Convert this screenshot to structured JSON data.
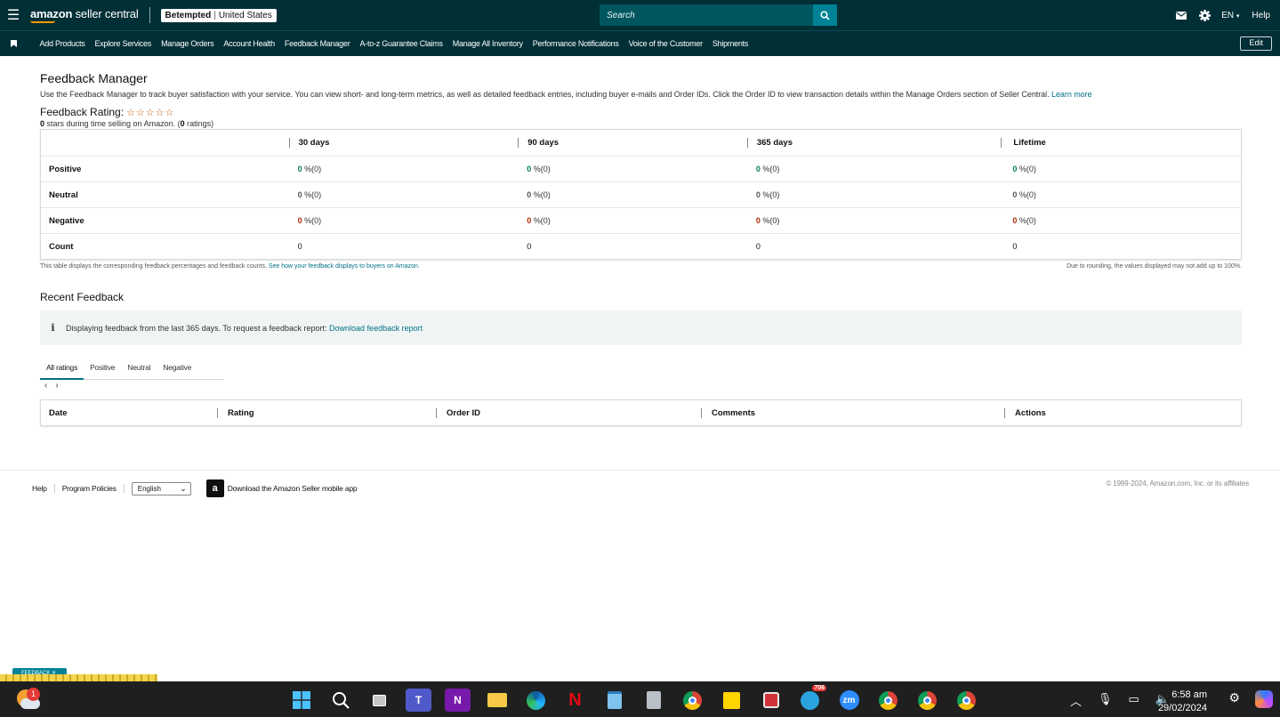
{
  "topbar": {
    "logo_brand": "amazon",
    "logo_suffix": "seller central",
    "store_name": "Betempted",
    "store_region": "United States",
    "search_placeholder": "Search",
    "language": "EN",
    "help": "Help"
  },
  "nav": {
    "items": [
      "Add Products",
      "Explore Services",
      "Manage Orders",
      "Account Health",
      "Feedback Manager",
      "A-to-z Guarantee Claims",
      "Manage All Inventory",
      "Performance Notifications",
      "Voice of the Customer",
      "Shipments"
    ],
    "edit": "Edit"
  },
  "page": {
    "title": "Feedback Manager",
    "intro": "Use the Feedback Manager to track buyer satisfaction with your service. You can view short- and long-term metrics, as well as detailed feedback entries, including buyer e-mails and Order IDs. Click the Order ID to view transaction details within the Manage Orders section of Seller Central.",
    "learn_more": "Learn more",
    "rating_label": "Feedback Rating:",
    "stars": "☆☆☆☆☆",
    "stars_count": "0",
    "stars_text_1": " stars during time selling on Amazon. (",
    "ratings_count": "0",
    "stars_text_2": " ratings)"
  },
  "feedback_table": {
    "columns": [
      "30 days",
      "90 days",
      "365 days",
      "Lifetime"
    ],
    "rows": [
      {
        "label": "Positive",
        "cells": [
          {
            "n": "0",
            "p": " %(0)"
          },
          {
            "n": "0",
            "p": " %(0)"
          },
          {
            "n": "0",
            "p": " %(0)"
          },
          {
            "n": "0",
            "p": " %(0)"
          }
        ]
      },
      {
        "label": "Neutral",
        "cells": [
          {
            "n": "0",
            "p": " %(0)"
          },
          {
            "n": "0",
            "p": " %(0)"
          },
          {
            "n": "0",
            "p": " %(0)"
          },
          {
            "n": "0",
            "p": " %(0)"
          }
        ]
      },
      {
        "label": "Negative",
        "cells": [
          {
            "n": "0",
            "p": " %(0)"
          },
          {
            "n": "0",
            "p": " %(0)"
          },
          {
            "n": "0",
            "p": " %(0)"
          },
          {
            "n": "0",
            "p": " %(0)"
          }
        ]
      },
      {
        "label": "Count",
        "cells": [
          "0",
          "0",
          "0",
          "0"
        ]
      }
    ],
    "note_left": "This table displays the corresponding feedback percentages and feedback counts.",
    "note_left_link": "See how your feedback displays to buyers on Amazon.",
    "note_right": "Due to rounding, the values displayed may not add up to 100%."
  },
  "recent": {
    "title": "Recent Feedback",
    "info_icon": "i",
    "info_text": "Displaying feedback from the last 365 days. To request a feedback report:",
    "info_link": "Download feedback report",
    "tabs": [
      "All ratings",
      "Positive",
      "Neutral",
      "Negative"
    ],
    "prev": "‹",
    "next": "›",
    "columns": [
      "Date",
      "Rating",
      "Order ID",
      "Comments",
      "Actions"
    ]
  },
  "footer": {
    "help": "Help",
    "program_policies": "Program Policies",
    "language_select": "English",
    "app_badge": "a",
    "app_text": "Download the Amazon Seller mobile app",
    "copyright": "© 1999-2024, Amazon.com, Inc. or its affiliates"
  },
  "feedback_tab": "FEEDBACK ✕",
  "taskbar": {
    "weather_badge": "1",
    "telegram_badge": "706",
    "time": "6:58 am",
    "date": "29/02/2024"
  },
  "colors": {
    "header_bg": "#002f36",
    "accent": "#008296",
    "link": "#007185",
    "positive": "#067d62",
    "negative": "#b12704"
  }
}
